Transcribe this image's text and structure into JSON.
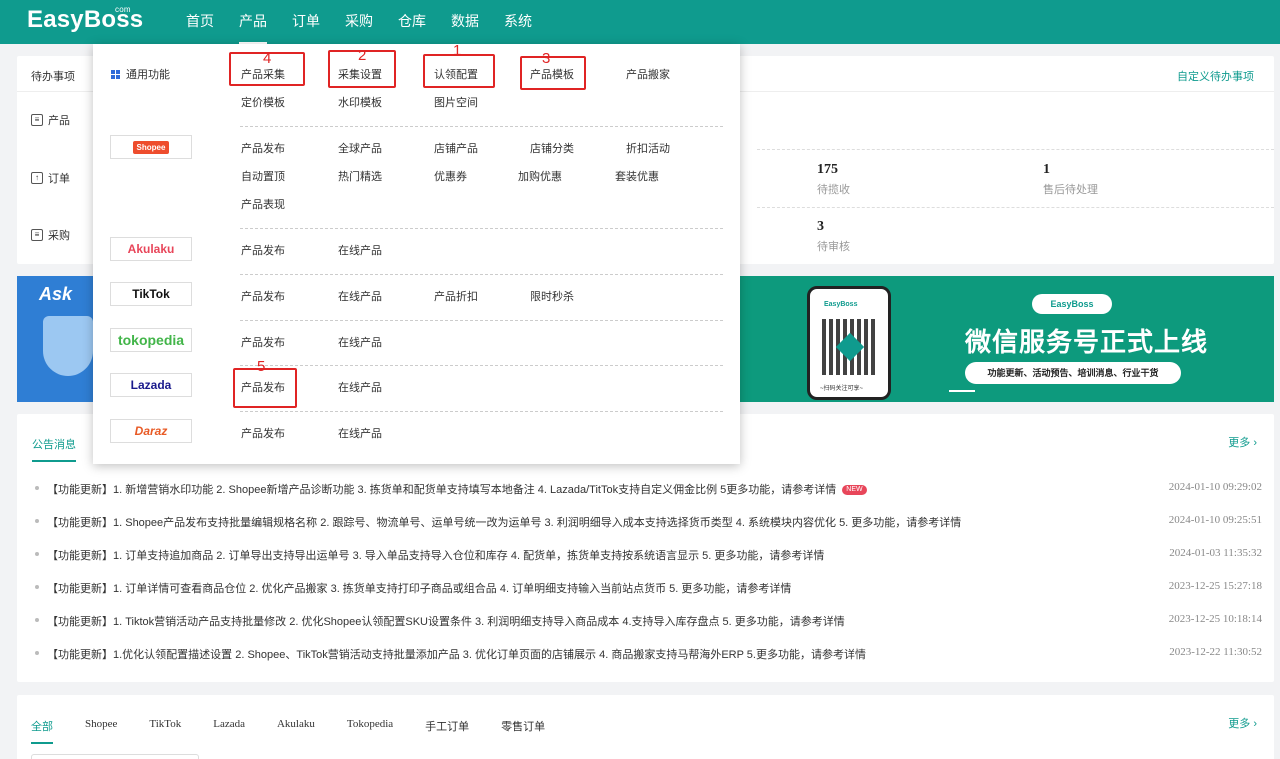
{
  "header": {
    "logo": "EasyBoss",
    "logo_sup": "com",
    "nav": [
      "首页",
      "产品",
      "订单",
      "采购",
      "仓库",
      "数据",
      "系统"
    ]
  },
  "todo": {
    "title": "待办事项",
    "custom": "自定义待办事项",
    "rows": [
      "产品",
      "订单",
      "采购"
    ],
    "stats": [
      {
        "num": "175",
        "label": "待揽收"
      },
      {
        "num": "1",
        "label": "售后待处理"
      },
      {
        "num": "3",
        "label": "待审核"
      }
    ]
  },
  "banner": {
    "left_text": "Ask",
    "brand": "EasyBoss",
    "title": "微信服务号正式上线",
    "subtitle": "功能更新、活动预告、培训消息、行业干货",
    "scan": "~扫码关注可享~"
  },
  "notice": {
    "tab": "公告消息",
    "more": "更多",
    "items": [
      {
        "text": "【功能更新】1. 新增营销水印功能 2. Shopee新增产品诊断功能 3. 拣货单和配货单支持填写本地备注 4. Lazada/TitTok支持自定义佣金比例 5更多功能，请参考详情",
        "time": "2024-01-10 09:29:02",
        "new": "NEW"
      },
      {
        "text": "【功能更新】1. Shopee产品发布支持批量编辑规格名称 2. 跟踪号、物流单号、运单号统一改为运单号 3. 利润明细导入成本支持选择货币类型 4. 系统模块内容优化 5. 更多功能，请参考详情",
        "time": "2024-01-10 09:25:51"
      },
      {
        "text": "【功能更新】1. 订单支持追加商品 2. 订单导出支持导出运单号 3. 导入单品支持导入仓位和库存 4. 配货单，拣货单支持按系统语言显示 5. 更多功能，请参考详情",
        "time": "2024-01-03 11:35:32"
      },
      {
        "text": "【功能更新】1. 订单详情可查看商品仓位 2. 优化产品搬家 3. 拣货单支持打印子商品或组合品 4. 订单明细支持输入当前站点货币 5. 更多功能，请参考详情",
        "time": "2023-12-25 15:27:18"
      },
      {
        "text": "【功能更新】1. Tiktok营销活动产品支持批量修改 2. 优化Shopee认领配置SKU设置条件 3. 利润明细支持导入商品成本 4.支持导入库存盘点 5. 更多功能，请参考详情",
        "time": "2023-12-25 10:18:14"
      },
      {
        "text": "【功能更新】1.优化认领配置描述设置 2. Shopee、TikTok营销活动支持批量添加产品 3. 优化订单页面的店铺展示 4. 商品搬家支持马帮海外ERP 5.更多功能，请参考详情",
        "time": "2023-12-22 11:30:52"
      }
    ]
  },
  "orders": {
    "tabs": [
      "全部",
      "Shopee",
      "TikTok",
      "Lazada",
      "Akulaku",
      "Tokopedia",
      "手工订单",
      "零售订单"
    ],
    "more": "更多"
  },
  "menu": {
    "general_label": "通用功能",
    "general_row1": [
      "产品采集",
      "采集设置",
      "认领配置",
      "产品模板",
      "产品搬家"
    ],
    "general_row2": [
      "定价模板",
      "水印模板",
      "图片空间"
    ],
    "shopee": {
      "logo": "Shopee",
      "row1": [
        "产品发布",
        "全球产品",
        "店铺产品",
        "店铺分类",
        "折扣活动"
      ],
      "row2": [
        "自动置顶",
        "热门精选",
        "优惠券",
        "加购优惠",
        "套装优惠"
      ],
      "row3": [
        "产品表现"
      ]
    },
    "akulaku": {
      "logo": "Akulaku",
      "items": [
        "产品发布",
        "在线产品"
      ]
    },
    "tiktok": {
      "logo": "TikTok",
      "items": [
        "产品发布",
        "在线产品",
        "产品折扣",
        "限时秒杀"
      ]
    },
    "tokopedia": {
      "logo": "tokopedia",
      "items": [
        "产品发布",
        "在线产品"
      ]
    },
    "lazada": {
      "logo": "Lazada",
      "items": [
        "产品发布",
        "在线产品"
      ]
    },
    "daraz": {
      "logo": "Daraz",
      "items": [
        "产品发布",
        "在线产品"
      ]
    },
    "annotations": [
      "4",
      "2",
      "1",
      "3",
      "5"
    ]
  },
  "colors": {
    "primary": "#0f9b8e",
    "annotation": "#e02424"
  }
}
